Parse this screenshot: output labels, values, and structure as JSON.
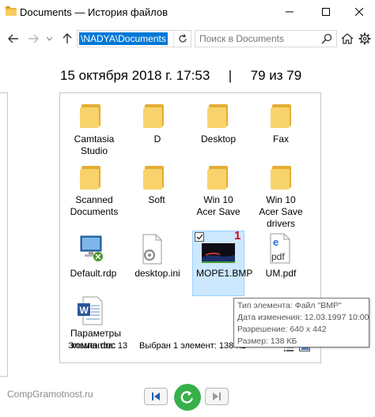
{
  "window": {
    "title": "Documents — История файлов",
    "controls": {
      "minimize": "minimize-icon",
      "maximize": "maximize-icon",
      "close": "close-icon"
    }
  },
  "navigation": {
    "address_value": "\\NADYA\\Documents",
    "search_placeholder": "Поиск в Documents",
    "icons": [
      "back-arrow-icon",
      "forward-arrow-icon",
      "up-arrow-icon",
      "refresh-icon",
      "search-icon",
      "home-icon",
      "gear-icon"
    ]
  },
  "history": {
    "date": "15 октября 2018 г. 17:53",
    "separator": "|",
    "position": "79 из 79"
  },
  "files": [
    {
      "label": "Camtasia Studio",
      "type": "folder"
    },
    {
      "label": "D",
      "type": "folder"
    },
    {
      "label": "Desktop",
      "type": "folder"
    },
    {
      "label": "Fax",
      "type": "folder"
    },
    {
      "label": "Scanned Documents",
      "type": "folder"
    },
    {
      "label": "Soft",
      "type": "folder"
    },
    {
      "label": "Win 10 Acer Save",
      "type": "folder"
    },
    {
      "label": "Win 10 Acer Save drivers",
      "type": "folder"
    },
    {
      "label": "Default.rdp",
      "type": "rdp"
    },
    {
      "label": "desktop.ini",
      "type": "ini"
    },
    {
      "label": "MOPE1.BMP",
      "type": "bmp",
      "selected": true
    },
    {
      "label": "UM.pdf",
      "type": "pdf"
    },
    {
      "label": "Параметры компа.doc",
      "type": "doc"
    }
  ],
  "badge": "1",
  "tooltip": {
    "lines": [
      "Тип элемента: Файл \"BMP\"",
      "Дата изменения: 12.03.1997 10:00",
      "Разрешение: 640 x 442",
      "Размер: 138 КБ"
    ]
  },
  "status": {
    "count": "Элементов: 13",
    "selection": "Выбран 1 элемент: 138 КБ"
  },
  "watermark": "CompGramotnost.ru",
  "colors": {
    "accent": "#0078d7",
    "restore": "#37b04a",
    "folder": "#f8d36b",
    "badge": "#d0021b"
  }
}
